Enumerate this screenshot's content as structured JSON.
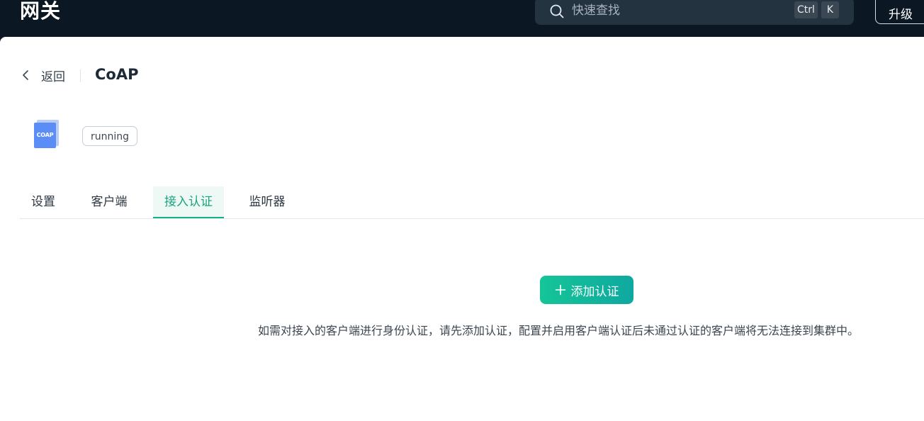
{
  "topbar": {
    "page_heading": "网关",
    "search": {
      "placeholder": "快速查找",
      "shortcut_keys": [
        "Ctrl",
        "K"
      ]
    },
    "upgrade_label": "升级"
  },
  "header": {
    "back_label": "返回",
    "title": "CoAP"
  },
  "gateway": {
    "logo_text": "COAP",
    "status": "running"
  },
  "tabs": [
    {
      "label": "设置",
      "active": false
    },
    {
      "label": "客户端",
      "active": false
    },
    {
      "label": "接入认证",
      "active": true
    },
    {
      "label": "监听器",
      "active": false
    }
  ],
  "empty_state": {
    "add_button_label": "添加认证",
    "hint": "如需对接入的客户端进行身份认证，请先添加认证，配置并启用客户端认证后未通过认证的客户端将无法连接到集群中。"
  },
  "colors": {
    "topbar_bg": "#0b1722",
    "accent": "#14b08b",
    "logo_blue": "#5b8df7"
  },
  "icons": {
    "search": "search-icon",
    "back": "chevron-left-icon",
    "plus": "plus-icon"
  }
}
